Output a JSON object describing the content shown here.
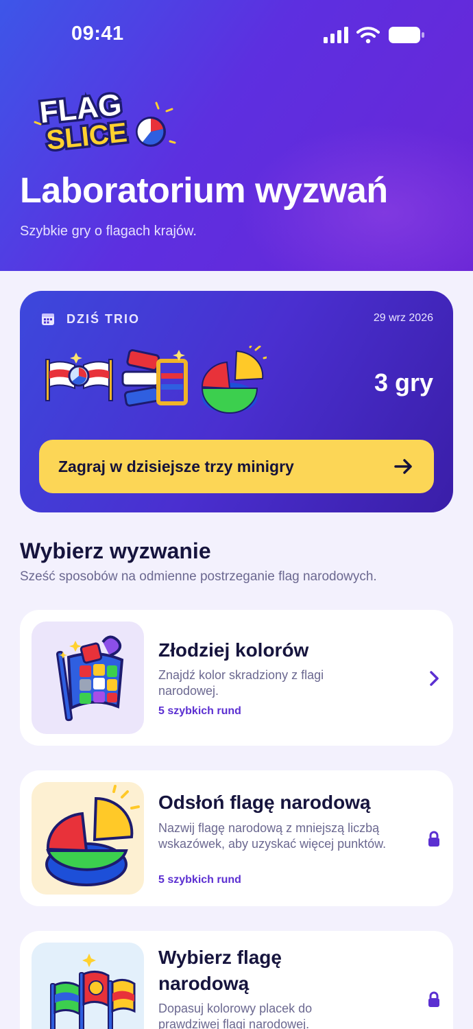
{
  "status_bar": {
    "time": "09:41"
  },
  "header": {
    "logo_text": "FLAG SLICE",
    "title": "Laboratorium wyzwań",
    "subtitle": "Szybkie gry o flagach krajów."
  },
  "daily_trio": {
    "label": "DZIŚ TRIO",
    "date": "29 wrz 2026",
    "count": "3 gry",
    "play_label": "Zagraj w dzisiejsze trzy minigry"
  },
  "section": {
    "title": "Wybierz wyzwanie",
    "subtitle": "Sześć sposobów na odmienne postrzeganie flag narodowych."
  },
  "challenges": [
    {
      "title": "Złodziej kolorów",
      "description": "Znajdź kolor skradziony z flagi narodowej.",
      "rounds": "5 szybkich rund",
      "state": "unlocked",
      "thumb_bg": "#ece6fb"
    },
    {
      "title": "Odsłoń flagę narodową",
      "description": "Nazwij flagę narodową z mniejszą liczbą wskazówek, aby uzyskać więcej punktów.",
      "rounds": "5 szybkich rund",
      "state": "locked",
      "thumb_bg": "#fdf0d2"
    },
    {
      "title": "Wybierz flagę narodową",
      "description": "Dopasuj kolorowy placek do prawdziwej flagi narodowej.",
      "state": "locked",
      "thumb_bg": "#e3f0fb"
    }
  ],
  "colors": {
    "accent": "#5b2fd1",
    "cta": "#fcd656",
    "heading": "#16143d"
  }
}
